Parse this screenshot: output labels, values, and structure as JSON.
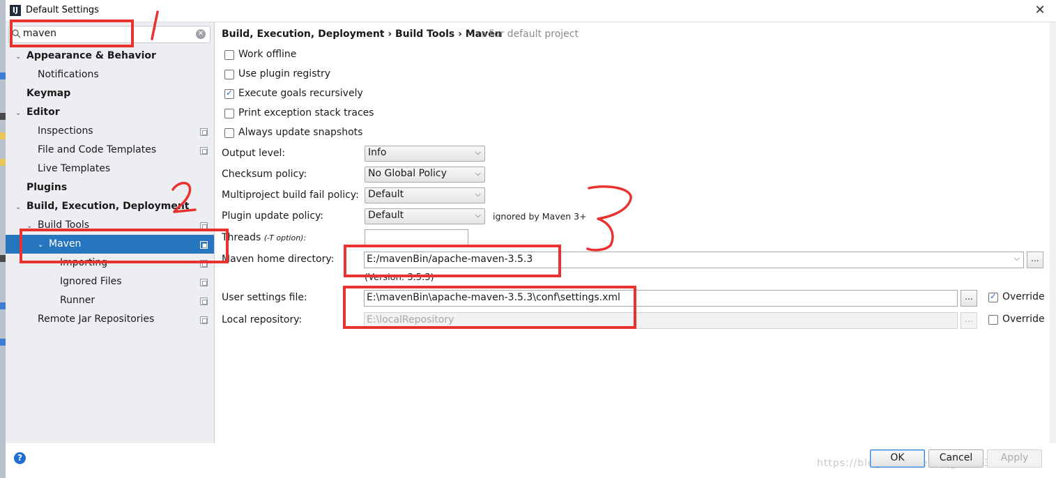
{
  "window": {
    "title": "Default Settings"
  },
  "search": {
    "value": "maven"
  },
  "sidebar": {
    "items": [
      {
        "label": "Appearance & Behavior"
      },
      {
        "label": "Notifications"
      },
      {
        "label": "Keymap"
      },
      {
        "label": "Editor"
      },
      {
        "label": "Inspections"
      },
      {
        "label": "File and Code Templates"
      },
      {
        "label": "Live Templates"
      },
      {
        "label": "Plugins"
      },
      {
        "label": "Build, Execution, Deployment"
      },
      {
        "label": "Build Tools"
      },
      {
        "label": "Maven"
      },
      {
        "label": "Importing"
      },
      {
        "label": "Ignored Files"
      },
      {
        "label": "Runner"
      },
      {
        "label": "Remote Jar Repositories"
      }
    ],
    "selected": "Maven"
  },
  "breadcrumb": {
    "path": "Build, Execution, Deployment › Build Tools › Maven",
    "scope": "For default project"
  },
  "options": [
    {
      "label": "Work offline",
      "checked": false
    },
    {
      "label": "Use plugin registry",
      "checked": false
    },
    {
      "label": "Execute goals recursively",
      "checked": true
    },
    {
      "label": "Print exception stack traces",
      "checked": false
    },
    {
      "label": "Always update snapshots",
      "checked": false
    }
  ],
  "fields": {
    "output_level": {
      "label": "Output level:",
      "value": "Info"
    },
    "checksum_policy": {
      "label": "Checksum policy:",
      "value": "No Global Policy"
    },
    "fail_policy": {
      "label": "Multiproject build fail policy:",
      "value": "Default"
    },
    "plugin_update": {
      "label": "Plugin update policy:",
      "value": "Default",
      "hint": "ignored by Maven 3+"
    },
    "threads": {
      "label": "Threads",
      "hint": "(-T option):",
      "value": ""
    },
    "home_dir": {
      "label": "Maven home directory:",
      "value": "E:/mavenBin/apache-maven-3.5.3",
      "version": "(Version: 3.5.3)"
    },
    "user_settings": {
      "label": "User settings file:",
      "value": "E:\\mavenBin\\apache-maven-3.5.3\\conf\\settings.xml",
      "override_label": "Override",
      "override": true
    },
    "local_repo": {
      "label": "Local repository:",
      "value": "E:\\localRepository",
      "override_label": "Override",
      "override": false
    }
  },
  "browse_label": "...",
  "buttons": {
    "ok": "OK",
    "cancel": "Cancel",
    "apply": "Apply"
  },
  "watermark": "https://blog.csdn.net/qq_28553075",
  "annotations": {
    "mark1": "1",
    "mark2": "2",
    "mark3": "3"
  },
  "colors": {
    "selection": "#2675bf",
    "annotation": "#e8322f",
    "sidebar_bg": "#eceef2"
  }
}
